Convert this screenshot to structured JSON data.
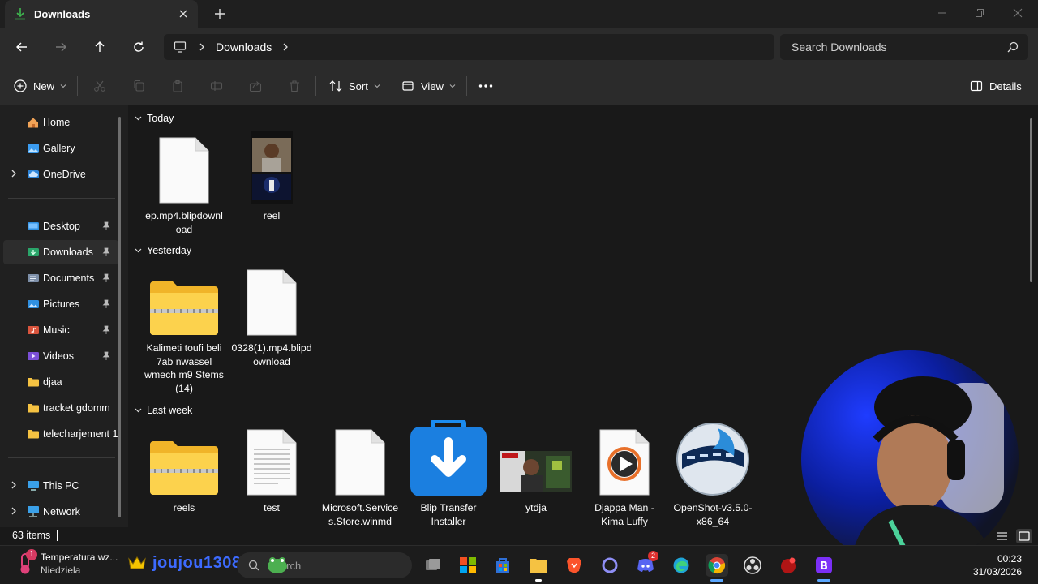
{
  "window": {
    "tab_title": "Downloads"
  },
  "nav": {
    "breadcrumb": "Downloads",
    "search_placeholder": "Search Downloads"
  },
  "command_bar": {
    "new_label": "New",
    "sort_label": "Sort",
    "view_label": "View",
    "details_label": "Details"
  },
  "sidebar": {
    "items": [
      {
        "label": "Home",
        "icon": "home-icon"
      },
      {
        "label": "Gallery",
        "icon": "gallery-icon"
      },
      {
        "label": "OneDrive",
        "icon": "cloud-icon"
      },
      {
        "label": "Desktop",
        "icon": "desktop-folder-icon"
      },
      {
        "label": "Downloads",
        "icon": "downloads-folder-icon"
      },
      {
        "label": "Documents",
        "icon": "documents-folder-icon"
      },
      {
        "label": "Pictures",
        "icon": "pictures-folder-icon"
      },
      {
        "label": "Music",
        "icon": "music-folder-icon"
      },
      {
        "label": "Videos",
        "icon": "videos-folder-icon"
      },
      {
        "label": "djaa",
        "icon": "folder-icon"
      },
      {
        "label": "tracket gdomm",
        "icon": "folder-icon"
      },
      {
        "label": "telecharjement 1",
        "icon": "folder-icon"
      },
      {
        "label": "This PC",
        "icon": "pc-icon"
      },
      {
        "label": "Network",
        "icon": "network-icon"
      }
    ]
  },
  "groups": {
    "today": "Today",
    "yesterday": "Yesterday",
    "last_week": "Last week"
  },
  "files": {
    "today": [
      {
        "name": "ep.mp4.blipdownload",
        "type": "blank-file"
      },
      {
        "name": "reel",
        "type": "video-thumbnail"
      }
    ],
    "yesterday": [
      {
        "name": "Kalimeti toufi beli 7ab nwassel wmech m9 Stems (14)",
        "type": "zip-folder"
      },
      {
        "name": "0328(1).mp4.blipdownload",
        "type": "blank-file"
      }
    ],
    "last_week": [
      {
        "name": "reels",
        "type": "zip-folder"
      },
      {
        "name": "test",
        "type": "text-file"
      },
      {
        "name": "Microsoft.Services.Store.winmd",
        "type": "blank-file"
      },
      {
        "name": "Blip Transfer Installer",
        "type": "installer"
      },
      {
        "name": "ytdja",
        "type": "image-thumbnail"
      },
      {
        "name": "Djappa Man - Kima Luffy",
        "type": "media-file"
      },
      {
        "name": "OpenShot-v3.5.0-x86_64",
        "type": "openshot-installer"
      }
    ]
  },
  "status": {
    "item_count": "63 items"
  },
  "taskbar": {
    "weather_title": "Temperatura wz...",
    "weather_sub": "Niedziela",
    "notification_badge": "1",
    "overlay_name": "joujou1308",
    "search_text": "Search",
    "discord_badge": "2",
    "time": "00:23",
    "date": "31/03/2026"
  }
}
